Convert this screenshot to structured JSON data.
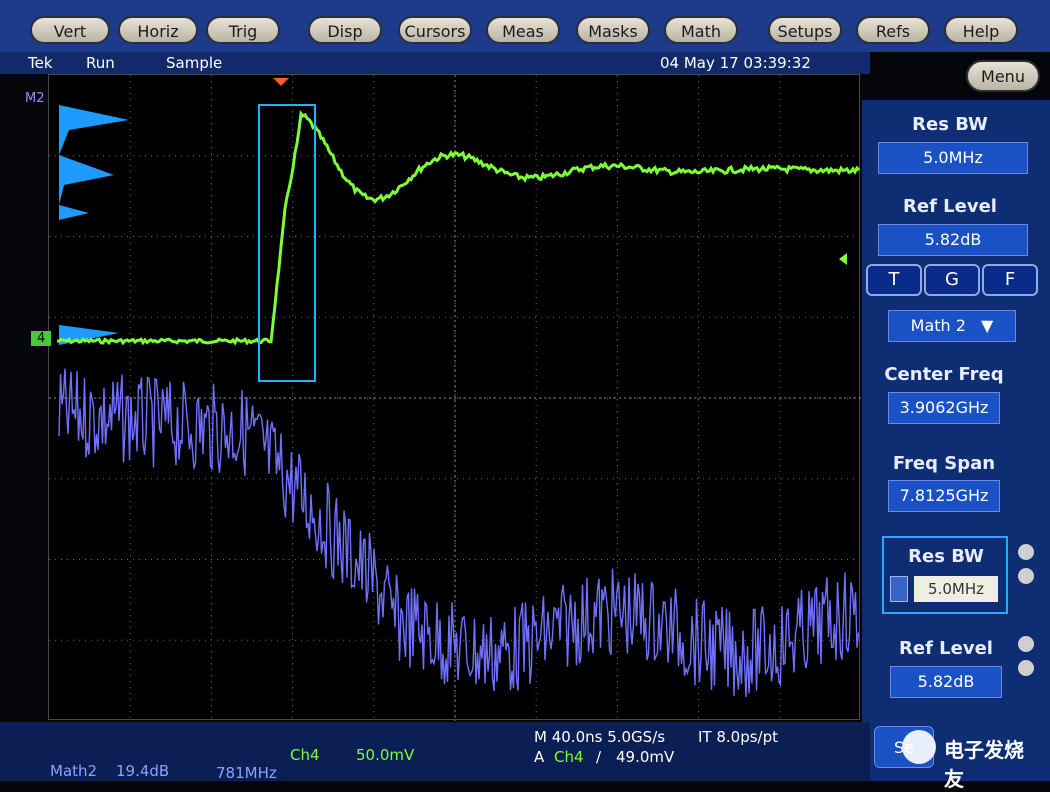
{
  "toolbar": {
    "buttons": [
      "Vert",
      "Horiz",
      "Trig",
      "Disp",
      "Cursors",
      "Meas",
      "Masks",
      "Math",
      "Setups",
      "Refs",
      "Help"
    ]
  },
  "status": {
    "brand": "Tek",
    "run_state": "Run",
    "acq_mode": "Sample",
    "datetime": "04 May 17 03:39:32"
  },
  "menu_label": "Menu",
  "screen": {
    "math_marker": "M2",
    "ch4_marker": "4"
  },
  "panel": {
    "res_bw_label": "Res BW",
    "res_bw_value": "5.0MHz",
    "ref_level_label": "Ref Level",
    "ref_level_value": "5.82dB",
    "tabs": [
      "T",
      "G",
      "F"
    ],
    "source_select": "Math 2",
    "center_freq_label": "Center Freq",
    "center_freq_value": "3.9062GHz",
    "freq_span_label": "Freq Span",
    "freq_span_value": "7.8125GHz",
    "res_bw2_label": "Res BW",
    "res_bw2_value": "5.0MHz",
    "ref_level2_label": "Ref Level",
    "ref_level2_value": "5.82dB",
    "bottom_btn_label": "Se"
  },
  "bottom": {
    "math_name": "Math2",
    "math_scale": "19.4dB",
    "math_rbw": "781MHz",
    "ch_name": "Ch4",
    "ch_scale": "50.0mV",
    "timebase": "M 40.0ns 5.0GS/s",
    "interp": "IT 8.0ps/pt",
    "trig_mode": "A",
    "trig_src": "Ch4",
    "trig_slope": "∕",
    "trig_level": "49.0mV"
  },
  "watermark": "电子发烧友",
  "colors": {
    "ch4_trace": "#7cff3a",
    "math_trace": "#7070ff",
    "histogram": "#1e9bff",
    "gate_box": "#1fb2ff",
    "grid": "#6b6b6b"
  }
}
